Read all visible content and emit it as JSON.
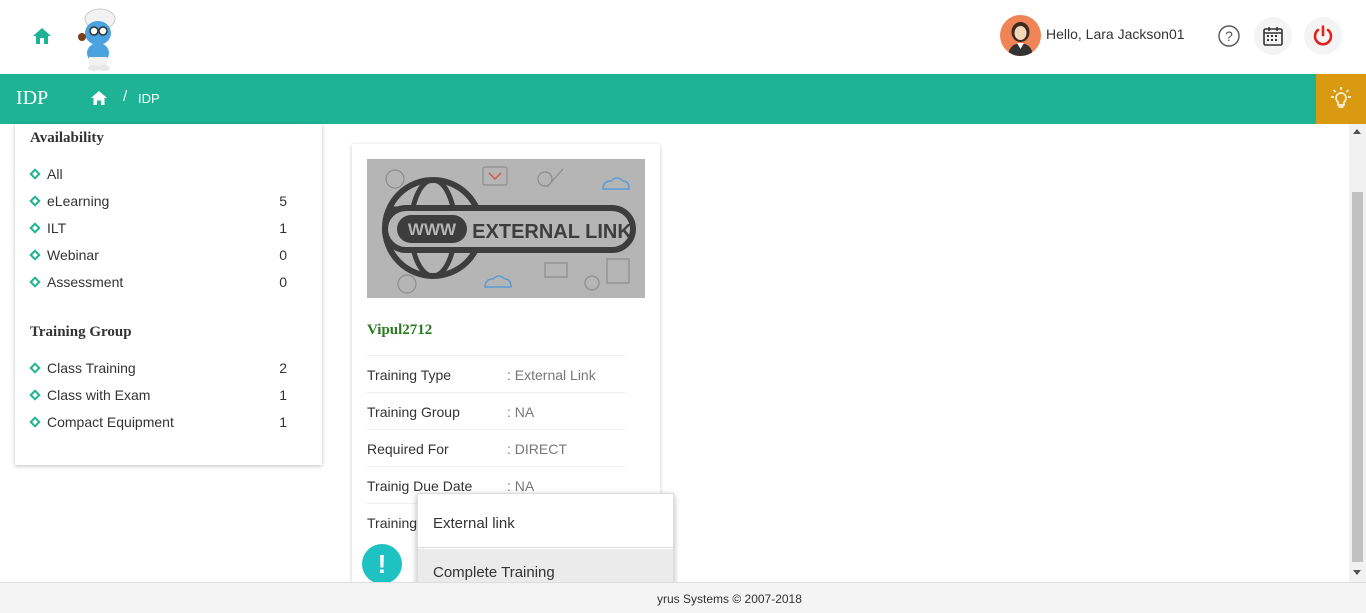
{
  "header": {
    "greeting": "Hello, Lara Jackson01",
    "help_symbol": "?",
    "icons": [
      "home-icon",
      "help-icon",
      "calendar-icon",
      "power-icon"
    ]
  },
  "navbar": {
    "title": "IDP",
    "breadcrumb_sep": "/",
    "breadcrumb_current": "IDP"
  },
  "sidebar": {
    "availability_title": "Availability",
    "availability": [
      {
        "label": "All",
        "count": ""
      },
      {
        "label": "eLearning",
        "count": "5"
      },
      {
        "label": "ILT",
        "count": "1"
      },
      {
        "label": "Webinar",
        "count": "0"
      },
      {
        "label": "Assessment",
        "count": "0"
      }
    ],
    "group_title": "Training Group",
    "groups": [
      {
        "label": "Class Training",
        "count": "2"
      },
      {
        "label": "Class with Exam",
        "count": "1"
      },
      {
        "label": "Compact Equipment",
        "count": "1"
      }
    ]
  },
  "card": {
    "image_text_www": "WWW",
    "image_text_main": "EXTERNAL LINK",
    "name": "Vipul2712",
    "details": [
      {
        "label": "Training Type",
        "value": ": External Link"
      },
      {
        "label": "Training Group",
        "value": ": NA"
      },
      {
        "label": "Required For",
        "value": ": DIRECT"
      },
      {
        "label": "Trainig Due Date",
        "value": ": NA"
      },
      {
        "label": "Training",
        "value": ""
      }
    ],
    "alert_symbol": "!"
  },
  "dropdown": {
    "items": [
      "External link",
      "Complete Training"
    ]
  },
  "footer": {
    "text": "yrus Systems © 2007-2018"
  },
  "colors": {
    "brand_green": "#1db394",
    "bulb_gold": "#d99a11",
    "name_green": "#2a7a1f",
    "alert_teal": "#1ec2c2",
    "power_red": "#e0241b"
  }
}
